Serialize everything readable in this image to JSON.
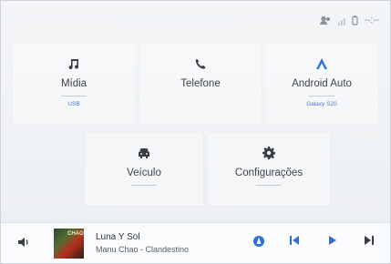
{
  "status": {
    "time": "--:--"
  },
  "tiles": {
    "media": {
      "label": "Mídia",
      "sub": "USB"
    },
    "phone": {
      "label": "Telefone"
    },
    "android_auto": {
      "label": "Android Auto",
      "sub": "Galaxy S20"
    },
    "vehicle": {
      "label": "Veículo"
    },
    "config": {
      "label": "Configurações"
    }
  },
  "player": {
    "title": "Luna Y Sol",
    "artist_album": "Manu Chao - Clandestino",
    "cover_text": "CHAO"
  },
  "colors": {
    "accent": "#2f6fd6",
    "text": "#40444a"
  }
}
